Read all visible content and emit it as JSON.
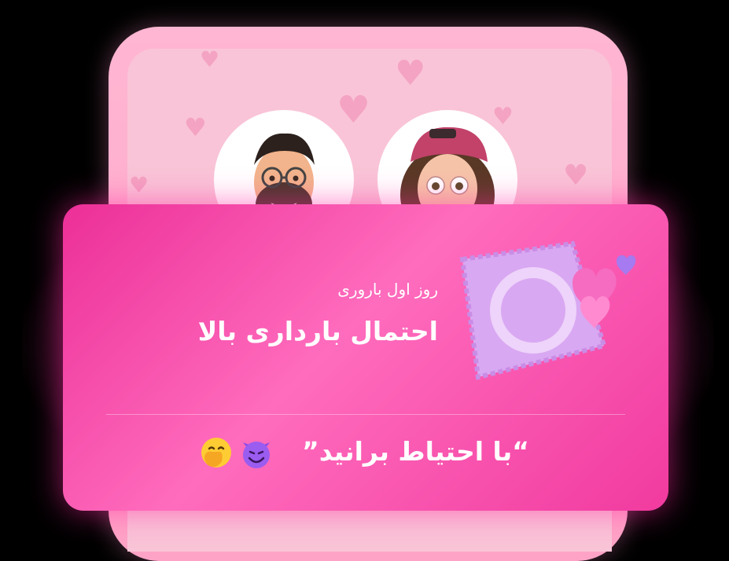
{
  "card": {
    "subtitle": "روز اول باروری",
    "title": "احتمال بارداری بالا",
    "quote": "“با احتیاط برانید”"
  },
  "icons": {
    "avatar_male": "man-memoji-avatar-icon",
    "avatar_female": "woman-memoji-avatar-icon",
    "condom": "condom-hearts-illustration-icon",
    "devil": "smiling-devil-emoji-icon",
    "shy": "hand-over-mouth-emoji-icon"
  },
  "colors": {
    "card_pink": "#ec2f98",
    "screen_pink": "#f9c4d7",
    "frame_pink": "#ffa3c6"
  }
}
